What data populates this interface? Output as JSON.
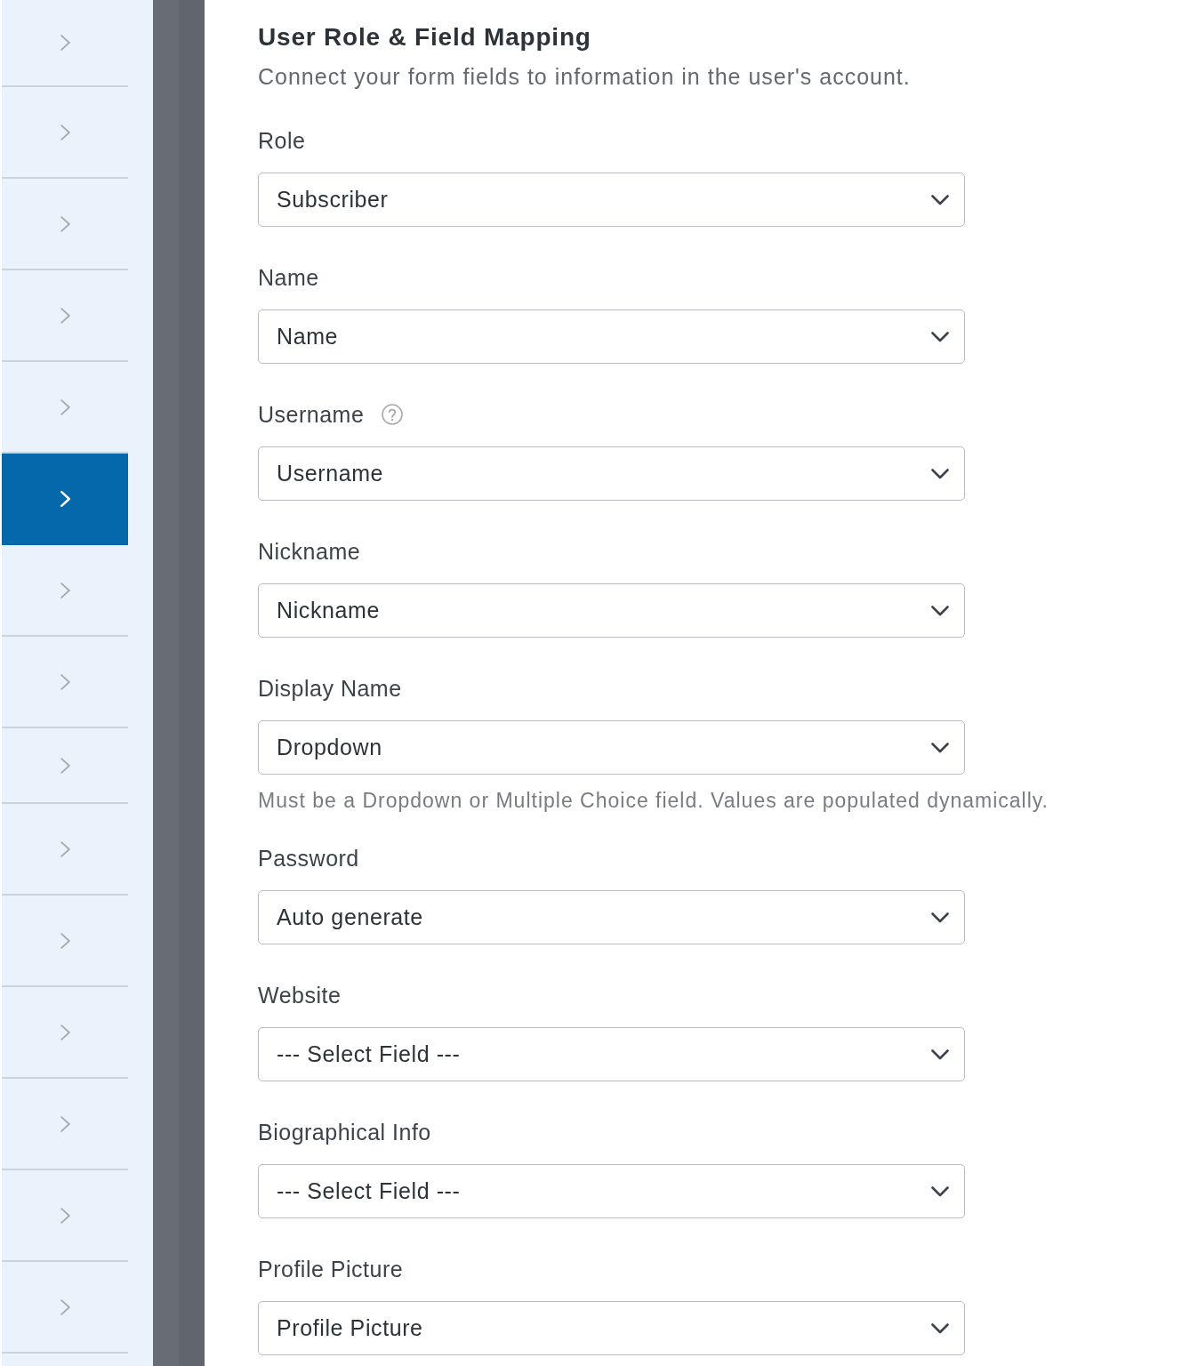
{
  "sidebar": {
    "items": [
      {
        "selected": false
      },
      {
        "selected": false
      },
      {
        "selected": false
      },
      {
        "selected": false
      },
      {
        "selected": false
      },
      {
        "selected": true
      },
      {
        "selected": false
      },
      {
        "selected": false
      },
      {
        "selected": false
      },
      {
        "selected": false
      },
      {
        "selected": false
      },
      {
        "selected": false
      },
      {
        "selected": false
      },
      {
        "selected": false
      },
      {
        "selected": false
      }
    ]
  },
  "section": {
    "title": "User Role & Field Mapping",
    "description": "Connect your form fields to information in the user's account."
  },
  "fields": [
    {
      "label": "Role",
      "value": "Subscriber",
      "help": false
    },
    {
      "label": "Name",
      "value": "Name",
      "help": false
    },
    {
      "label": "Username",
      "value": "Username",
      "help": true
    },
    {
      "label": "Nickname",
      "value": "Nickname",
      "help": false
    },
    {
      "label": "Display Name",
      "value": "Dropdown",
      "help": false,
      "hint": "Must be a Dropdown or Multiple Choice field. Values are populated dynamically."
    },
    {
      "label": "Password",
      "value": "Auto generate",
      "help": false
    },
    {
      "label": "Website",
      "value": "--- Select Field ---",
      "help": false
    },
    {
      "label": "Biographical Info",
      "value": "--- Select Field ---",
      "help": false
    },
    {
      "label": "Profile Picture",
      "value": "Profile Picture",
      "help": false
    }
  ]
}
